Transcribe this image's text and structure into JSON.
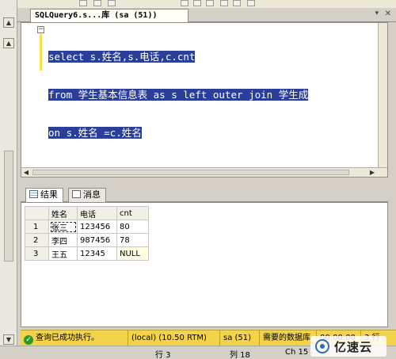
{
  "document_tab": {
    "title": "SQLQuery6.s...库 (sa (51))",
    "pin_icon": "pin-icon",
    "close_label": "✕"
  },
  "editor": {
    "lines": [
      "select s.姓名,s.电话,c.cnt",
      "from 学生基本信息表 as s left outer join 学生成",
      "on s.姓名 =c.姓名"
    ],
    "selection_color": "#2a3f99"
  },
  "result_tabs": [
    {
      "label": "结果",
      "icon": "grid-icon",
      "active": true
    },
    {
      "label": "消息",
      "icon": "message-icon",
      "active": false
    }
  ],
  "results": {
    "columns": [
      "姓名",
      "电话",
      "cnt"
    ],
    "rows": [
      {
        "num": "1",
        "cells": [
          "张三",
          "123456",
          "80"
        ]
      },
      {
        "num": "2",
        "cells": [
          "李四",
          "987456",
          "78"
        ]
      },
      {
        "num": "3",
        "cells": [
          "王五",
          "12345",
          "NULL"
        ]
      }
    ]
  },
  "status": {
    "message": "查询已成功执行。",
    "server": "(local) (10.50 RTM)",
    "user": "sa (51)",
    "database": "需要的数据库",
    "time": "00:00:00",
    "rows": "3 行",
    "accent": "#f3d349"
  },
  "position": {
    "line": "行 3",
    "col": "列 18",
    "ch": "Ch 15"
  },
  "watermark": {
    "text": "亿速云"
  }
}
